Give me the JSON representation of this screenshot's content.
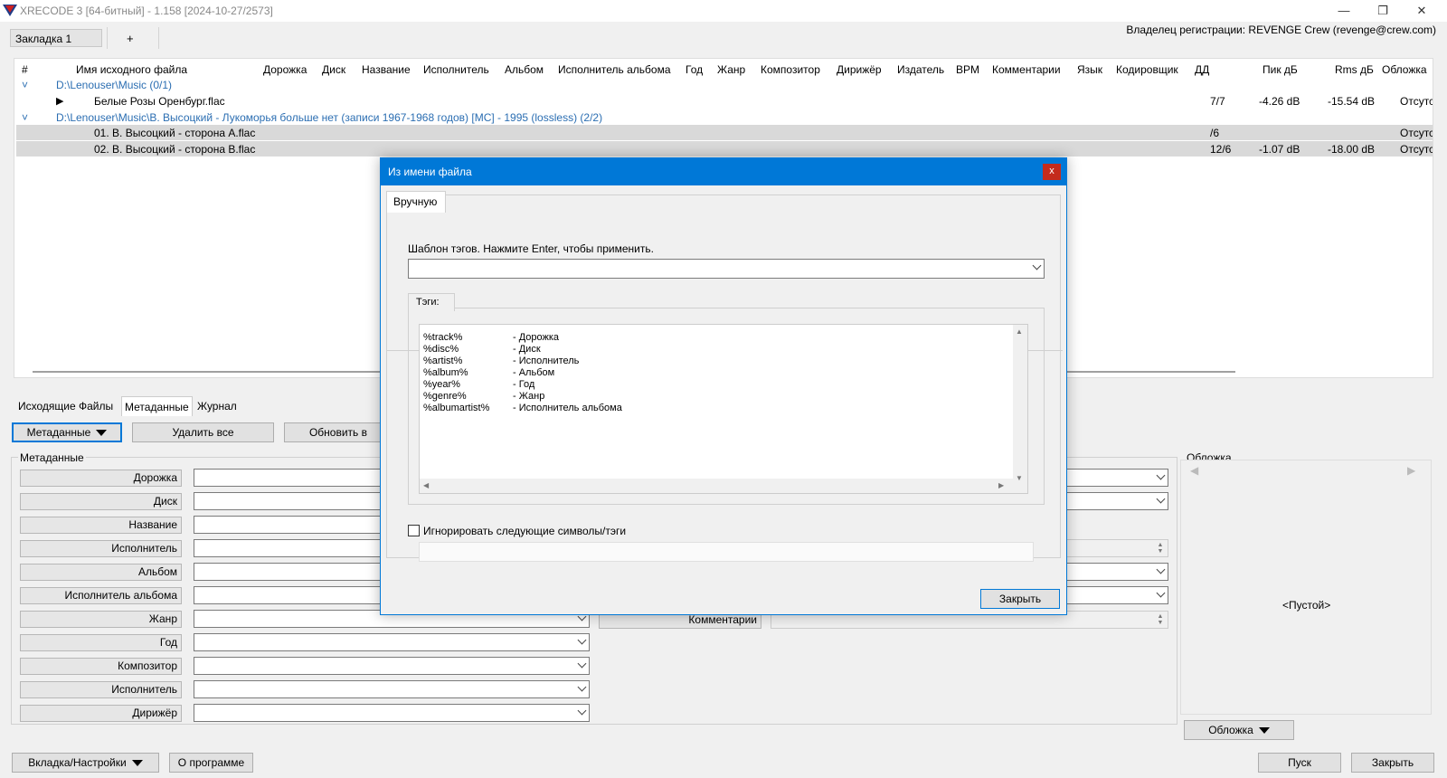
{
  "app": {
    "title": "XRECODE 3 [64-битный] - 1.158 [2024-10-27/2573]",
    "owner": "Владелец регистрации: REVENGE Crew (revenge@crew.com)",
    "min_glyph": "—",
    "max_glyph": "❐",
    "close_glyph": "✕"
  },
  "tabs": {
    "tab1": "Закладка 1",
    "add": "+"
  },
  "columns": [
    "#",
    "Имя исходного файла",
    "Дорожка",
    "Диск",
    "Название",
    "Исполнитель",
    "Альбом",
    "Исполнитель альбома",
    "Год",
    "Жанр",
    "Композитор",
    "Дирижёр",
    "Издатель",
    "BPM",
    "Комментарии",
    "Язык",
    "Кодировщик",
    "ДД",
    "Пик дБ",
    "Rms дБ",
    "Обложка"
  ],
  "rows": [
    {
      "folder": "D:\\Lenouser\\Music (0/1)"
    },
    {
      "name": "Белые Розы Оренбург.flac",
      "dd": "7/7",
      "peak": "-4.26 dB",
      "rms": "-15.54 dB",
      "cover": "Отсутс"
    },
    {
      "folder": "D:\\Lenouser\\Music\\В. Высоцкий - Лукоморья больше нет (записи 1967-1968 годов) [МС] - 1995 (lossless) (2/2)"
    },
    {
      "name": "01. В. Высоцкий - сторона A.flac",
      "dd": "/6",
      "peak": "",
      "rms": "",
      "cover": "Отсутс"
    },
    {
      "name": "02. В. Высоцкий - сторона B.flac",
      "dd": "12/6",
      "peak": "-1.07 dB",
      "rms": "-18.00 dB",
      "cover": "Отсутс"
    }
  ],
  "bottom_tabs": [
    "Исходящие Файлы",
    "Метаданные",
    "Журнал"
  ],
  "toolbar": {
    "metadata": "Метаданные",
    "delete_all": "Удалить все",
    "update": "Обновить в"
  },
  "meta_group": "Метаданные",
  "meta_labels": [
    "Дорожка",
    "Диск",
    "Название",
    "Исполнитель",
    "Альбом",
    "Исполнитель альбома",
    "Жанр",
    "Год",
    "Композитор",
    "Исполнитель",
    "Дирижёр"
  ],
  "comment_label": "Комментарии",
  "cover": {
    "group": "Обложка",
    "empty": "<Пустой>",
    "button": "Обложка",
    "prev": "◀",
    "next": "▶"
  },
  "footer": {
    "tab_settings": "Вкладка/Настройки",
    "about": "О программе",
    "start": "Пуск",
    "close": "Закрыть"
  },
  "dialog": {
    "title": "Из имени файла",
    "close_glyph": "x",
    "tab": "Вручную",
    "template_label": "Шаблон тэгов. Нажмите Enter, чтобы применить.",
    "template_value": "",
    "tags_tab": "Тэги:",
    "tags": [
      {
        "tag": "%track%",
        "desc": "- Дорожка"
      },
      {
        "tag": "%disc%",
        "desc": "- Диск"
      },
      {
        "tag": "%artist%",
        "desc": "- Исполнитель"
      },
      {
        "tag": "%album%",
        "desc": "- Альбом"
      },
      {
        "tag": "%year%",
        "desc": "- Год"
      },
      {
        "tag": "%genre%",
        "desc": "- Жанр"
      },
      {
        "tag": "%albumartist%",
        "desc": "- Исполнитель альбома"
      }
    ],
    "ignore_label": "Игнорировать следующие символы/тэги",
    "ignore_checked": false,
    "ignore_value": "",
    "close_button": "Закрыть"
  }
}
